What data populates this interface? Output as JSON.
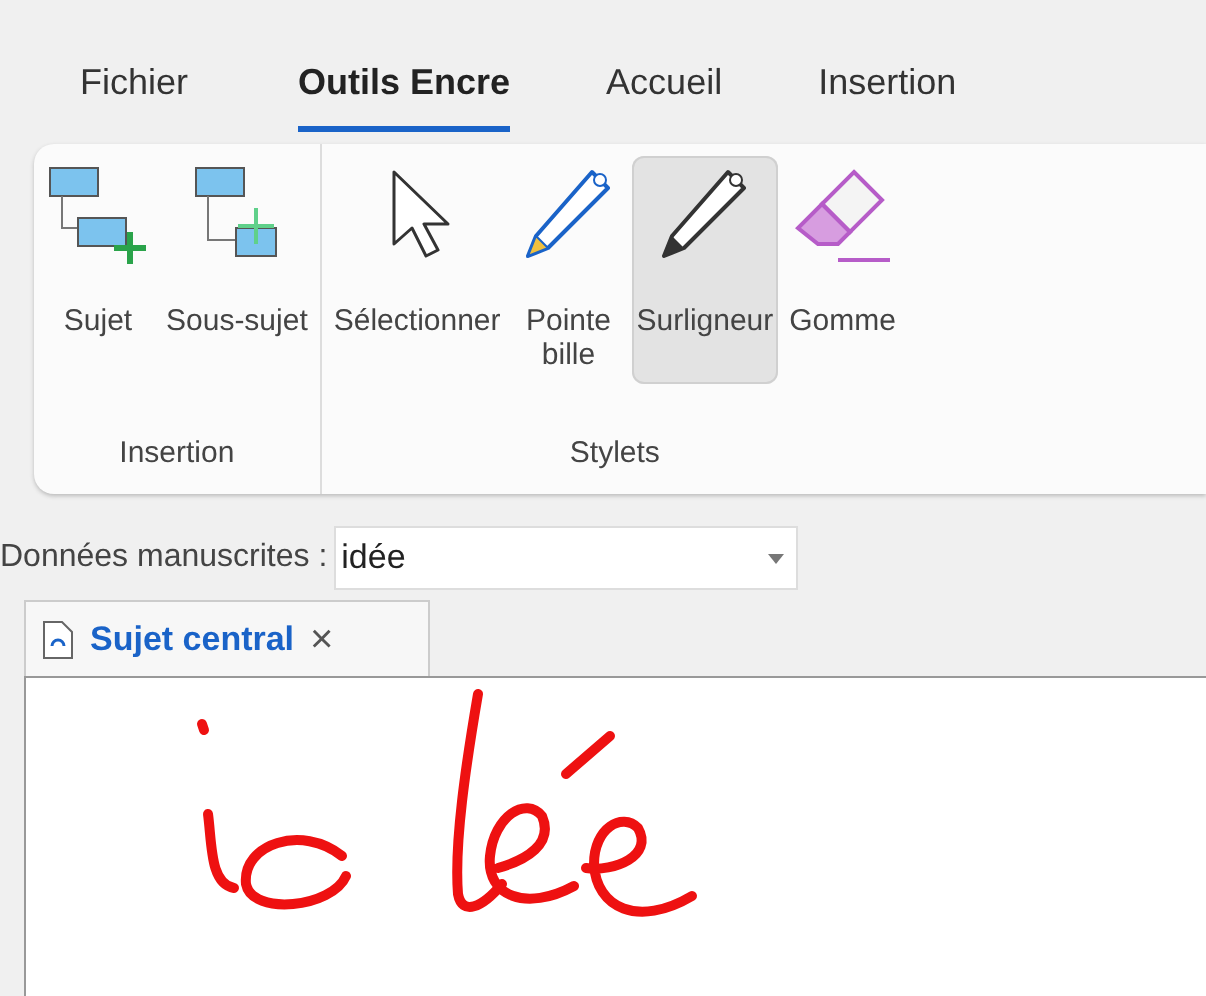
{
  "ribbon_tabs": [
    {
      "label": "Fichier",
      "selected": false
    },
    {
      "label": "Outils Encre",
      "selected": true
    },
    {
      "label": "Accueil",
      "selected": false
    },
    {
      "label": "Insertion",
      "selected": false
    }
  ],
  "ribbon_groups": [
    {
      "label": "Insertion",
      "buttons": [
        {
          "label": "Sujet",
          "kind": "topic",
          "selected": false
        },
        {
          "label": "Sous-sujet",
          "kind": "subtopic",
          "selected": false
        }
      ]
    },
    {
      "label": "Stylets",
      "buttons": [
        {
          "label": "Sélectionner",
          "kind": "pointer",
          "selected": false
        },
        {
          "label": "Pointe bille",
          "kind": "pen",
          "selected": false
        },
        {
          "label": "Surligneur",
          "kind": "pencil",
          "selected": true
        },
        {
          "label": "Gomme",
          "kind": "eraser",
          "selected": false
        }
      ]
    }
  ],
  "ink_field": {
    "label": "Données manuscrites :",
    "value": "idée"
  },
  "document_tabs": [
    {
      "label": "Sujet central",
      "close": "×",
      "selected": true
    }
  ]
}
